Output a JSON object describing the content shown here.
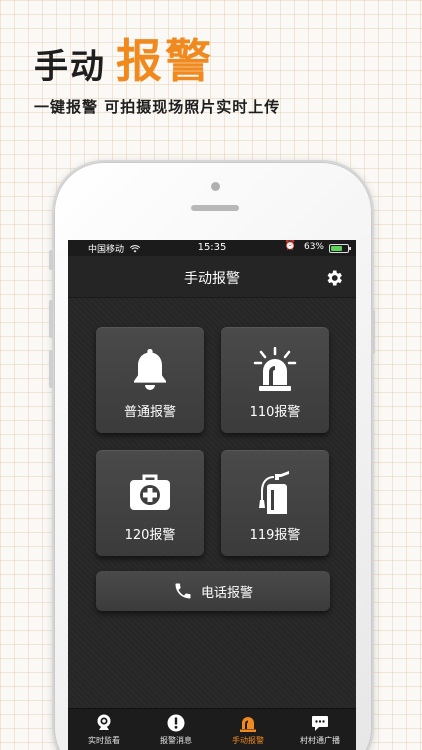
{
  "headline": {
    "part1": "手动",
    "part2": "报警"
  },
  "subline": "一键报警 可拍摄现场照片实时上传",
  "status_bar": {
    "carrier": "中国移动",
    "time": "15:35",
    "battery": "63%"
  },
  "nav": {
    "title": "手动报警",
    "settings_icon": "gear-icon"
  },
  "tiles": [
    {
      "label": "普通报警",
      "icon": "bell-icon"
    },
    {
      "label": "110报警",
      "icon": "siren-icon"
    },
    {
      "label": "120报警",
      "icon": "first-aid-kit-icon"
    },
    {
      "label": "119报警",
      "icon": "fire-extinguisher-icon"
    }
  ],
  "phone_button": {
    "label": "电话报警",
    "icon": "phone-icon"
  },
  "tabs": [
    {
      "label": "实时监看",
      "icon": "camera-icon",
      "active": false
    },
    {
      "label": "报警消息",
      "icon": "alert-icon",
      "active": false
    },
    {
      "label": "手动报警",
      "icon": "siren-icon",
      "active": true
    },
    {
      "label": "村村通广播",
      "icon": "chat-icon",
      "active": false
    }
  ],
  "colors": {
    "accent": "#f08a1f",
    "screen_bg": "#232323",
    "tile_bg": "#424242",
    "battery": "#5dd35a"
  }
}
